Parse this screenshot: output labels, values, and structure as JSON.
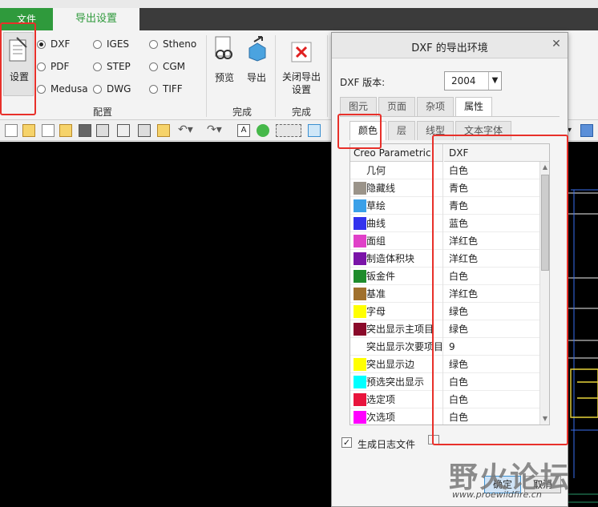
{
  "tabs": {
    "file": "文件",
    "export_setup": "导出设置"
  },
  "ribbon": {
    "setup_label": "设置",
    "formats_col1": [
      "DXF",
      "PDF",
      "Medusa"
    ],
    "formats_col2": [
      "IGES",
      "STEP",
      "DWG"
    ],
    "formats_col3": [
      "Stheno",
      "CGM",
      "TIFF"
    ],
    "selected_format": "DXF",
    "config_label": "配置",
    "preview_label": "预览",
    "export_label": "导出",
    "finish_label_1": "完成",
    "close_label": "关闭导出设置",
    "finish_label_2": "完成"
  },
  "dialog": {
    "title": "DXF 的导出环境",
    "version_label": "DXF 版本:",
    "version_value": "2004",
    "tabs": [
      "图元",
      "页面",
      "杂项",
      "属性"
    ],
    "active_tab": "属性",
    "subtabs": [
      "颜色",
      "层",
      "线型",
      "文本字体"
    ],
    "active_subtab": "颜色",
    "col_headers": [
      "Creo Parametric",
      "DXF"
    ],
    "rows": [
      {
        "name": "几何",
        "color": "",
        "value": "白色"
      },
      {
        "name": "隐藏线",
        "color": "#9b948a",
        "value": "青色"
      },
      {
        "name": "草绘",
        "color": "#3aa0e8",
        "value": "青色"
      },
      {
        "name": "曲线",
        "color": "#3333ee",
        "value": "蓝色"
      },
      {
        "name": "面组",
        "color": "#e040c8",
        "value": "洋红色"
      },
      {
        "name": "制造体积块",
        "color": "#7a14a8",
        "value": "洋红色"
      },
      {
        "name": "钣金件",
        "color": "#1f8c2c",
        "value": "白色"
      },
      {
        "name": "基准",
        "color": "#a0702c",
        "value": "洋红色"
      },
      {
        "name": "字母",
        "color": "#ffff00",
        "value": "绿色"
      },
      {
        "name": "突出显示主项目",
        "color": "#8a0a2a",
        "value": "绿色"
      },
      {
        "name": "突出显示次要项目",
        "color": "",
        "value": "9"
      },
      {
        "name": "突出显示边",
        "color": "#ffff00",
        "value": "绿色"
      },
      {
        "name": "预选突出显示",
        "color": "#00ffff",
        "value": "白色"
      },
      {
        "name": "选定项",
        "color": "#e8143c",
        "value": "白色"
      },
      {
        "name": "次选项",
        "color": "#ff00ff",
        "value": "白色"
      }
    ],
    "log_label": "生成日志文件",
    "ok_label": "确定",
    "cancel_label": "取消"
  },
  "watermark": {
    "text": "野火论坛",
    "url": "www.proewildfire.cn"
  },
  "colors": {
    "accent_green": "#2f9a3c",
    "highlight_red": "#e8302a"
  }
}
